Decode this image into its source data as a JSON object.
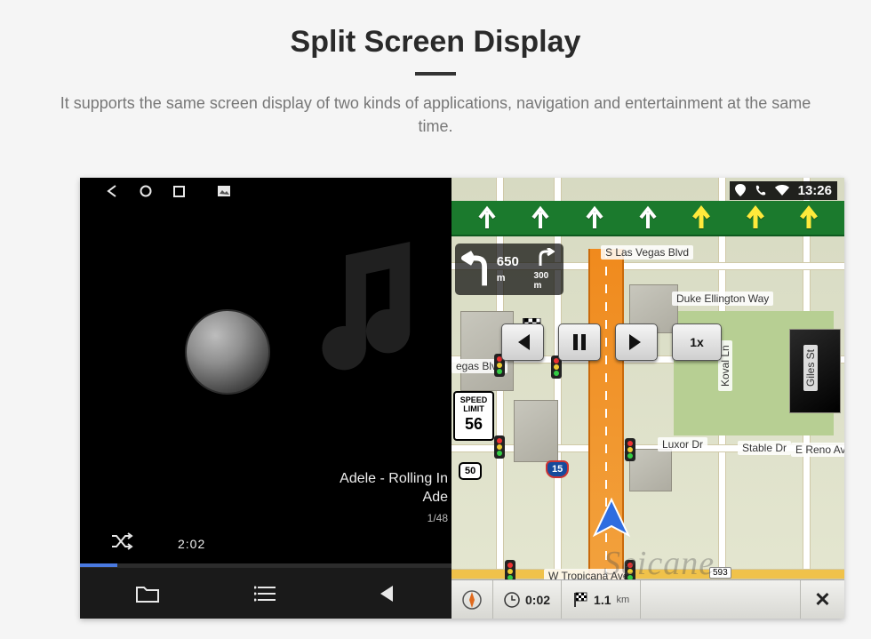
{
  "page": {
    "title": "Split Screen Display",
    "subtitle": "It supports the same screen display of two kinds of applications, navigation and entertainment at the same time."
  },
  "status": {
    "clock": "13:26"
  },
  "player": {
    "track_title": "Adele - Rolling In",
    "artist": "Ade",
    "track_index": "1/48",
    "elapsed": "2:02"
  },
  "nav": {
    "turn_distance_main": "650",
    "turn_distance_main_unit": "m",
    "turn_distance_sub": "300",
    "turn_distance_sub_unit": "m",
    "speed_limit_label": "SPEED LIMIT",
    "speed_limit_value": "56",
    "playback_speed": "1x",
    "eta_hours": "0:02",
    "remaining_distance": "1.1",
    "remaining_distance_unit": "km",
    "route_us": "50",
    "route_interstate": "15",
    "address_num": "593",
    "streets": {
      "s_las_vegas": "S Las Vegas Blvd",
      "tropicana": "W Tropicana Ave",
      "duke": "Duke Ellington Way",
      "koval": "Koval Ln",
      "reno": "E Reno Ave",
      "luxor": "Luxor Dr",
      "giles": "Giles St",
      "stable": "Stable Dr",
      "vegas_blvd_tag": "egas Blvd"
    }
  },
  "watermark": "Seicane"
}
